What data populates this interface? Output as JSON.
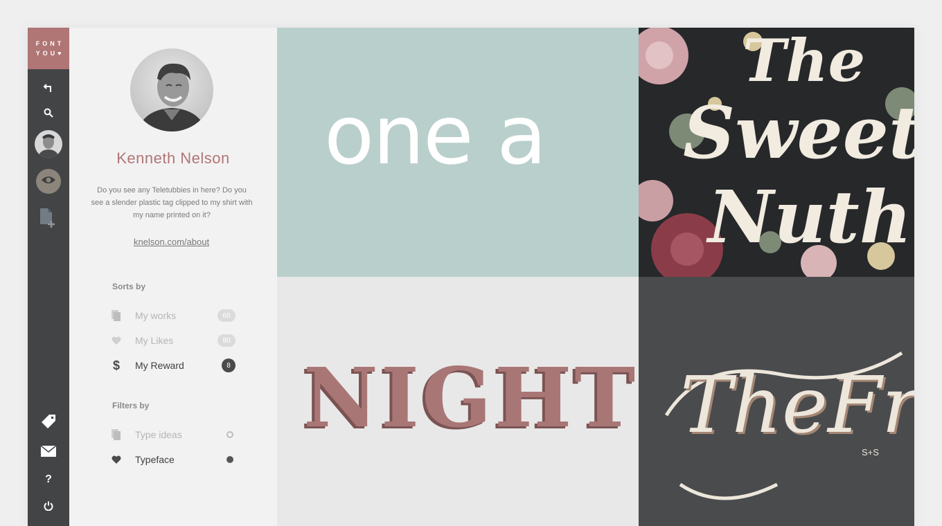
{
  "brand": {
    "line1": "FONT",
    "line2": "YOU♥",
    "color": "#b07575"
  },
  "rail": {
    "icons": [
      "back-icon",
      "search-icon",
      "avatar",
      "eye-icon",
      "add-file-icon",
      "tag-icon",
      "mail-icon",
      "help-icon",
      "power-icon"
    ],
    "help_label": "?"
  },
  "profile": {
    "name": "Kenneth Nelson",
    "bio": "Do you see any Teletubbies in here? Do you see a slender plastic tag clipped to my shirt with my name printed on it?",
    "link": "knelson.com/about"
  },
  "sorts": {
    "title": "Sorts by",
    "items": [
      {
        "label": "My works",
        "count": "60",
        "icon": "files-icon",
        "active": false
      },
      {
        "label": "My Likes",
        "count": "80",
        "icon": "heart-icon",
        "active": false
      },
      {
        "label": "My Reward",
        "count": "8",
        "icon": "dollar-icon",
        "active": true
      }
    ]
  },
  "filters": {
    "title": "Filters by",
    "items": [
      {
        "label": "Type ideas",
        "icon": "files-icon",
        "selected": false
      },
      {
        "label": "Typeface",
        "icon": "heart-icon",
        "selected": true
      }
    ]
  },
  "tiles": {
    "one_a": {
      "text": "one a",
      "bg": "#b9cfcb"
    },
    "sweet": {
      "line1": "The",
      "line2": "Sweet",
      "line3": "Nuth",
      "bg": "#26282a"
    },
    "night": {
      "text": "NIGHT",
      "bg": "#e9e8e8"
    },
    "fray": {
      "text": "TheFray",
      "sub": "S+S",
      "bg": "#4a4b4d"
    }
  }
}
